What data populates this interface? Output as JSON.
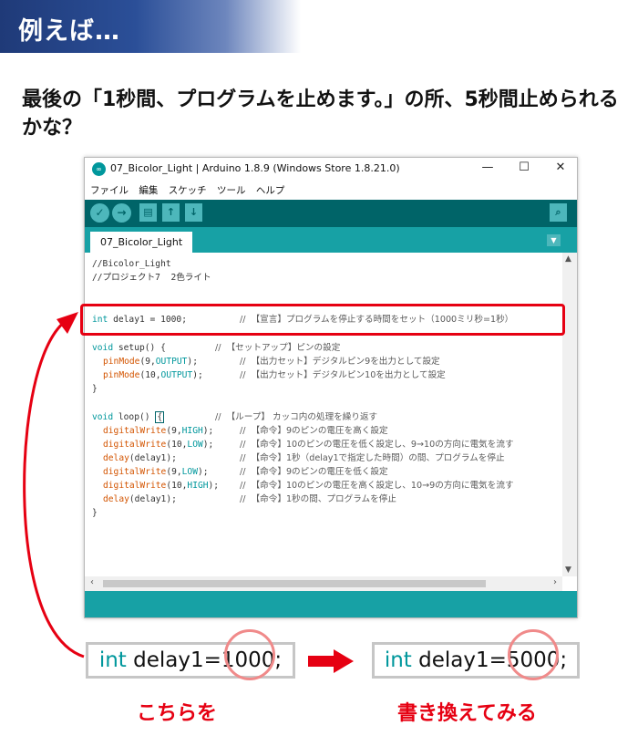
{
  "banner": {
    "title": "例えば…"
  },
  "question": {
    "text": "最後の「1秒間、プログラムを止めます。」の所、5秒間止められるかな？"
  },
  "window": {
    "icon_text": "∞",
    "title": "07_Bicolor_Light | Arduino 1.8.9 (Windows Store 1.8.21.0)",
    "controls": {
      "minimize": "—",
      "maximize": "☐",
      "close": "✕"
    }
  },
  "menu": [
    "ファイル",
    "編集",
    "スケッチ",
    "ツール",
    "ヘルプ"
  ],
  "toolbar": {
    "verify": "✓",
    "upload": "→",
    "new": "▤",
    "open": "↑",
    "save": "↓",
    "serial": "⌕"
  },
  "tab": {
    "label": "07_Bicolor_Light",
    "menu": "▼"
  },
  "code": {
    "l1": "//Bicolor_Light",
    "l2": "//プロジェクト7  2色ライト",
    "l4_kw": "int",
    "l4_rest": " delay1 = 1000;",
    "l4_cmt": "//  【宣言】プログラムを停止する時間をセット（1000ミリ秒=1秒）",
    "l6_kw": "void",
    "l6_rest": " setup() {",
    "l6_cmt": "//  【セットアップ】ピンの設定",
    "l7_fn": "pinMode",
    "l7_a": "(9,",
    "l7_cn": "OUTPUT",
    "l7_b": ");",
    "l7_cmt": "//  【出力セット】デジタルピン9を出力として設定",
    "l8_fn": "pinMode",
    "l8_a": "(10,",
    "l8_cn": "OUTPUT",
    "l8_b": ");",
    "l8_cmt": "//  【出力セット】デジタルピン10を出力として設定",
    "l9": "}",
    "l11_kw": "void",
    "l11_rest": " loop() ",
    "l11_brace": "{",
    "l11_cmt": "//  【ループ】 カッコ内の処理を繰り返す",
    "l12_fn": "digitalWrite",
    "l12_a": "(9,",
    "l12_cn": "HIGH",
    "l12_b": ");",
    "l12_cmt": "//  【命令】9のピンの電圧を高く設定",
    "l13_fn": "digitalWrite",
    "l13_a": "(10,",
    "l13_cn": "LOW",
    "l13_b": ");",
    "l13_cmt": "//  【命令】10のピンの電圧を低く設定し、9→10の方向に電気を流す",
    "l14_fn": "delay",
    "l14_a": "(delay1);",
    "l14_cmt": "//  【命令】1秒（delay1で指定した時間）の間、プログラムを停止",
    "l15_fn": "digitalWrite",
    "l15_a": "(9,",
    "l15_cn": "LOW",
    "l15_b": ");",
    "l15_cmt": "//  【命令】9のピンの電圧を低く設定",
    "l16_fn": "digitalWrite",
    "l16_a": "(10,",
    "l16_cn": "HIGH",
    "l16_b": ");",
    "l16_cmt": "//  【命令】10のピンの電圧を高く設定し、10→9の方向に電気を流す",
    "l17_fn": "delay",
    "l17_a": "(delay1);",
    "l17_cmt": "//  【命令】1秒の間、プログラムを停止",
    "l18": "}"
  },
  "before": {
    "kw": "int",
    "text": " delay1=1000;",
    "caption": "こちらを"
  },
  "after": {
    "kw": "int",
    "text": " delay1=5000;",
    "caption": "書き換えてみる"
  },
  "colors": {
    "accent_red": "#e60012",
    "arduino_teal": "#00979c",
    "toolbar_dark": "#006468"
  }
}
